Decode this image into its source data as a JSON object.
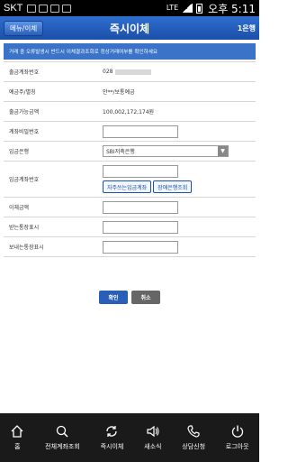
{
  "statusbar": {
    "carrier": "SKT",
    "network": "LTE",
    "time": "오후 5:11"
  },
  "header": {
    "menu_label": "메뉴/이체",
    "title": "즉시이체",
    "bank_label": "1은행"
  },
  "notice": "거래 중 오류발생시 반드시 이체결과조회로 정상거래여부를 확인하세요",
  "form": {
    "rows": [
      {
        "label": "출금계좌번호",
        "value": "028"
      },
      {
        "label": "예금주/별칭",
        "value": "안**/보통예금"
      },
      {
        "label": "출금가능금액",
        "value": "100,002,172,174원"
      },
      {
        "label": "계좌비밀번호"
      },
      {
        "label": "입금은행",
        "select_value": "SBI저축은행"
      },
      {
        "label": "입금계좌번호",
        "btn1": "자주쓰는입금계좌",
        "btn2": "장애은행조회"
      },
      {
        "label": "이체금액"
      },
      {
        "label": "받는통장표시"
      },
      {
        "label": "보내는통장표시"
      }
    ]
  },
  "actions": {
    "ok_label": "확인",
    "cancel_label": "취소"
  },
  "bottomnav": [
    {
      "icon": "home-icon",
      "label": "홈"
    },
    {
      "icon": "search-icon",
      "label": "전체계좌조회"
    },
    {
      "icon": "transfer-icon",
      "label": "즉시이체"
    },
    {
      "icon": "speaker-icon",
      "label": "새소식"
    },
    {
      "icon": "phone-icon",
      "label": "상담신청"
    },
    {
      "icon": "power-icon",
      "label": "로그아웃"
    }
  ]
}
